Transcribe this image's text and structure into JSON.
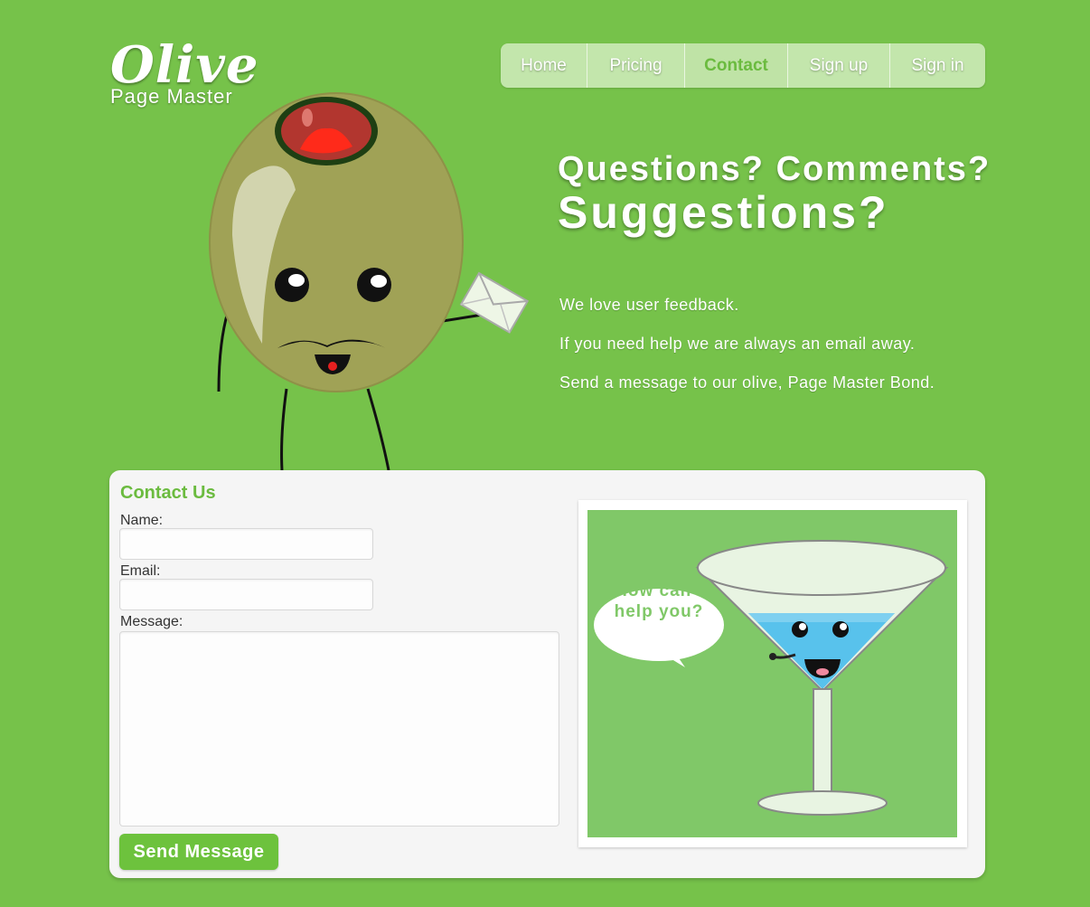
{
  "logo": {
    "title": "Olive",
    "subtitle": "Page Master"
  },
  "nav": {
    "items": [
      "Home",
      "Pricing",
      "Contact",
      "Sign up",
      "Sign in"
    ],
    "active": "Contact"
  },
  "headline": {
    "line1": "Questions? Comments?",
    "line2": "Suggestions?"
  },
  "intro": [
    "We love user feedback.",
    "If you need help we are always an email away.",
    "Send a message to our olive, Page Master Bond."
  ],
  "form": {
    "title": "Contact Us",
    "name_label": "Name:",
    "email_label": "Email:",
    "message_label": "Message:",
    "name_value": "",
    "email_value": "",
    "message_value": "",
    "submit_label": "Send Message"
  },
  "illustration": {
    "bubble_line1": "How can I",
    "bubble_line2": "help you?"
  },
  "colors": {
    "background": "#76c24a",
    "accent": "#6bbb3f",
    "nav_bg": "#c3e6ac",
    "button": "#6dc23d"
  }
}
